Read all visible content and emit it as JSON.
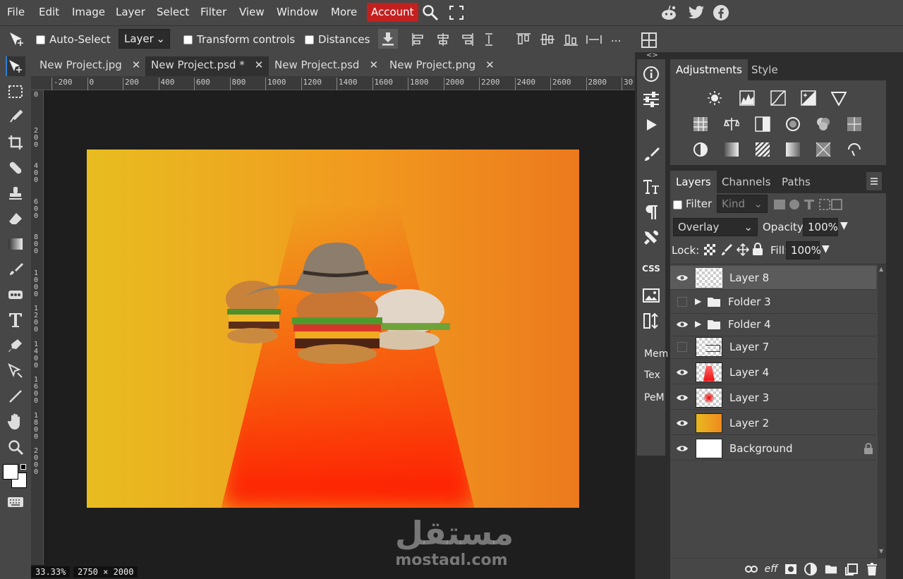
{
  "menu": {
    "items": [
      "File",
      "Edit",
      "Image",
      "Layer",
      "Select",
      "Filter",
      "View",
      "Window",
      "More"
    ],
    "account": "Account"
  },
  "options": {
    "auto_select": "Auto-Select",
    "layer_select": "Layer",
    "transform_controls": "Transform controls",
    "distances": "Distances",
    "more": "..."
  },
  "tabs": [
    {
      "label": "New Project.jpg",
      "active": false
    },
    {
      "label": "New Project.psd *",
      "active": true
    },
    {
      "label": "New Project.psd",
      "active": false
    },
    {
      "label": "New Project.png",
      "active": false
    }
  ],
  "ruler": {
    "h_ticks": [
      "-200",
      "0",
      "200",
      "400",
      "600",
      "800",
      "1000",
      "1200",
      "1400",
      "1600",
      "1800",
      "2000",
      "2200",
      "2400",
      "2600",
      "2800",
      "30"
    ],
    "v_ticks": [
      "0",
      "200",
      "400",
      "600",
      "800",
      "1000",
      "1200",
      "1400",
      "1600",
      "1800",
      "2000"
    ]
  },
  "status": {
    "zoom": "33.33%",
    "size": "2750 × 2000"
  },
  "strip": {
    "css": "CSS",
    "mem": "Mem",
    "tex": "Tex",
    "pem": "PeM",
    "collapse_left": "<>",
    "collapse_right": "><"
  },
  "adjustments": {
    "tab1": "Adjustments",
    "tab2": "Style"
  },
  "layers_panel": {
    "tab1": "Layers",
    "tab2": "Channels",
    "tab3": "Paths",
    "filter_label": "Filter",
    "kind": "Kind",
    "blend": "Overlay",
    "opacity_label": "Opacity:",
    "opacity": "100%",
    "lock_label": "Lock:",
    "fill_label": "Fill:",
    "fill": "100%",
    "layers": [
      {
        "name": "Layer 8",
        "visible": true,
        "type": "layer",
        "selected": true
      },
      {
        "name": "Folder 3",
        "visible": false,
        "type": "folder",
        "selected": false
      },
      {
        "name": "Folder 4",
        "visible": true,
        "type": "folder",
        "selected": false
      },
      {
        "name": "Layer 7",
        "visible": false,
        "type": "layer",
        "selected": false
      },
      {
        "name": "Layer 4",
        "visible": true,
        "type": "layer",
        "selected": false
      },
      {
        "name": "Layer 3",
        "visible": true,
        "type": "layer",
        "selected": false
      },
      {
        "name": "Layer 2",
        "visible": true,
        "type": "layer",
        "selected": false
      },
      {
        "name": "Background",
        "visible": true,
        "type": "background",
        "selected": false
      }
    ]
  },
  "watermark": {
    "arabic": "مستقل",
    "latin": "mostaql.com"
  },
  "colors": {
    "accent": "#c3201f",
    "panel": "#474747",
    "dark": "#2d2d2d"
  }
}
